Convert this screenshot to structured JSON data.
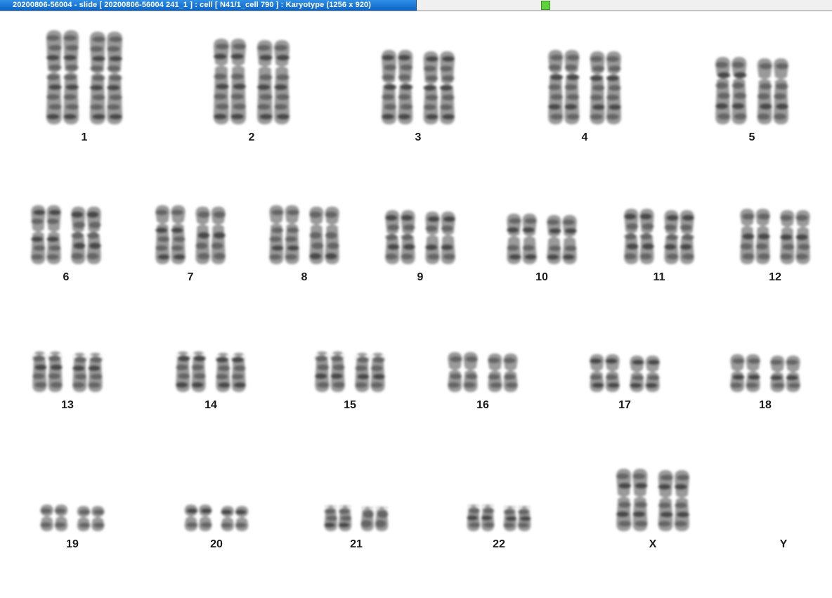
{
  "window": {
    "title": "20200806-56004 - slide [ 20200806-56004 241_1 ] : cell [ N41/1_cell 790 ] : Karyotype  (1256 x 920)"
  },
  "karyotype": {
    "pairs": [
      {
        "label": "1",
        "count": 2,
        "size": "xl",
        "shape": "meta"
      },
      {
        "label": "2",
        "count": 2,
        "size": "xl",
        "shape": "sub"
      },
      {
        "label": "3",
        "count": 2,
        "size": "l",
        "shape": "meta"
      },
      {
        "label": "4",
        "count": 2,
        "size": "l",
        "shape": "sub"
      },
      {
        "label": "5",
        "count": 2,
        "size": "l",
        "shape": "sub"
      },
      {
        "label": "6",
        "count": 2,
        "size": "m",
        "shape": "meta"
      },
      {
        "label": "7",
        "count": 2,
        "size": "m",
        "shape": "sub"
      },
      {
        "label": "8",
        "count": 2,
        "size": "m",
        "shape": "sub"
      },
      {
        "label": "9",
        "count": 2,
        "size": "m",
        "shape": "meta"
      },
      {
        "label": "10",
        "count": 2,
        "size": "m",
        "shape": "meta"
      },
      {
        "label": "11",
        "count": 2,
        "size": "m",
        "shape": "meta"
      },
      {
        "label": "12",
        "count": 2,
        "size": "m",
        "shape": "sub"
      },
      {
        "label": "13",
        "count": 2,
        "size": "s",
        "shape": "acro"
      },
      {
        "label": "14",
        "count": 2,
        "size": "s",
        "shape": "acro"
      },
      {
        "label": "15",
        "count": 2,
        "size": "s",
        "shape": "acro"
      },
      {
        "label": "16",
        "count": 2,
        "size": "s",
        "shape": "meta"
      },
      {
        "label": "17",
        "count": 2,
        "size": "s",
        "shape": "meta"
      },
      {
        "label": "18",
        "count": 2,
        "size": "s",
        "shape": "meta"
      },
      {
        "label": "19",
        "count": 2,
        "size": "xs",
        "shape": "meta"
      },
      {
        "label": "20",
        "count": 2,
        "size": "xs",
        "shape": "meta"
      },
      {
        "label": "21",
        "count": 2,
        "size": "xs",
        "shape": "acro"
      },
      {
        "label": "22",
        "count": 2,
        "size": "xs",
        "shape": "acro"
      },
      {
        "label": "X",
        "count": 2,
        "size": "l",
        "shape": "meta"
      },
      {
        "label": "Y",
        "count": 0,
        "size": "xs",
        "shape": "acro"
      }
    ]
  },
  "colors": {
    "titlebar": "#0a64c8",
    "status_indicator": "#5fd13a",
    "chromosome_dark": "#3a3a3a",
    "chromosome_light": "#9a9a9a",
    "label": "#1a1a1a"
  },
  "icons": {
    "status_indicator": "status-square-icon"
  }
}
